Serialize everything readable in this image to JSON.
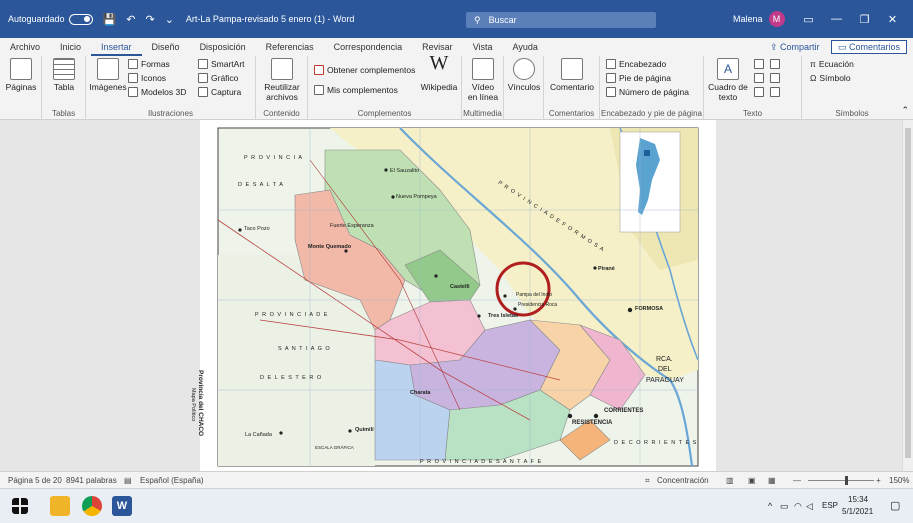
{
  "titlebar": {
    "autosave_label": "Autoguardado",
    "doc_title": "Art-La Pampa-revisado 5 enero (1)  -  Word",
    "search_label": "Buscar",
    "user_name": "Malena",
    "user_initial": "M"
  },
  "tabs": [
    "Archivo",
    "Inicio",
    "Insertar",
    "Diseño",
    "Disposición",
    "Referencias",
    "Correspondencia",
    "Revisar",
    "Vista",
    "Ayuda"
  ],
  "active_tab": "Insertar",
  "share_label": "Compartir",
  "comments_label": "Comentarios",
  "ribbon": {
    "paginas": "Páginas",
    "tabla": "Tabla",
    "tablas_group": "Tablas",
    "imagenes": "Imágenes",
    "formas": "Formas",
    "iconos": "Iconos",
    "modelos3d": "Modelos 3D",
    "smartart": "SmartArt",
    "grafico": "Gráfico",
    "captura": "Captura",
    "ilustraciones_group": "Ilustraciones",
    "reutilizar": "Reutilizar",
    "archivos": "archivos",
    "contenido_group": "Contenido",
    "obtener_complementos": "Obtener complementos",
    "mis_complementos": "Mis complementos",
    "wikipedia": "Wikipedia",
    "complementos_group": "Complementos",
    "video": "Vídeo",
    "en_linea": "en línea",
    "multimedia_group": "Multimedia",
    "vinculos": "Vínculos",
    "comentario": "Comentario",
    "comentarios_group": "Comentarios",
    "encabezado": "Encabezado",
    "pie_pagina": "Pie de página",
    "numero_pagina": "Número de página",
    "encabezado_group": "Encabezado y pie de página",
    "cuadro_texto": "Cuadro de",
    "texto": "texto",
    "texto_group": "Texto",
    "ecuacion": "Ecuación",
    "simbolo": "Símbolo",
    "simbolos_group": "Símbolos"
  },
  "map": {
    "prov_salta_1": "P R O V I N C I A",
    "prov_salta_2": "D E    S A L T A",
    "prov_formosa": "P R O V I N C I A   D E   F O R M O S A",
    "prov_santiago_1": "P R O V I N C I A   D E",
    "prov_santiago_2": "S A N T I A G O",
    "prov_santiago_3": "D E L   E S T E R O",
    "prov_santafe": "P R O V I N C I A   D E   S A N T A   F E",
    "prov_corrientes": "D E   C O R R I E N T E S",
    "paraguay_1": "RCA.",
    "paraguay_2": "DEL",
    "paraguay_3": "PARAGUAY",
    "monte_quemado": "Monte Quemado",
    "castelli": "Castelli",
    "pampa_indio": "Pampa del Indio",
    "pres_roca": "Presidencia Roca",
    "tres_isletas": "Tres Isletas",
    "resistencia": "RESISTENCIA",
    "corrientes": "CORRIENTES",
    "formosa": "FORMOSA",
    "charata": "Charata",
    "quimili": "Quimilí",
    "la_canada": "La Cañada",
    "nueva_pompeya": "Nueva Pompeya",
    "fuerte_esperanza": "Fuerte Esperanza",
    "el_sauzalito": "El Sauzalito",
    "taco_pozo": "Taco Pozo",
    "pirane": "Pirané",
    "side_title": "Provincia del CHACO",
    "side_sub": "Mapa Político",
    "legend": "ESCALA GRÁFICA"
  },
  "status": {
    "page": "Página 5 de 20",
    "words": "8941 palabras",
    "language": "Español (España)",
    "focus": "Concentración",
    "zoom": "150%"
  },
  "taskbar": {
    "lang": "ESP",
    "time": "15:34",
    "date": "5/1/2021"
  },
  "colors": {
    "word_blue": "#2b579a",
    "highlight_circle": "#b01e1e"
  }
}
